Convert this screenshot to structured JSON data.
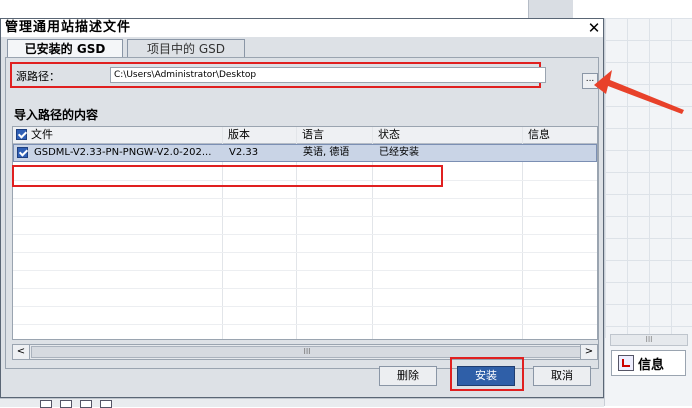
{
  "dialog": {
    "title": "管理通用站描述文件",
    "close_glyph": "✕"
  },
  "tabs": [
    {
      "label": "已安装的 GSD",
      "active": true
    },
    {
      "label": "项目中的 GSD",
      "active": false
    }
  ],
  "source": {
    "label": "源路径：",
    "path": "C:\\Users\\Administrator\\Desktop",
    "browse_label": "..."
  },
  "section_title": "导入路径的内容",
  "table": {
    "columns": [
      "文件",
      "版本",
      "语言",
      "状态",
      "信息"
    ],
    "rows": [
      {
        "checked": true,
        "file": "GSDML-V2.33-PN-PNGW-V2.0-202...",
        "version": "V2.33",
        "language": "英语, 德语",
        "status": "已经安装",
        "info": ""
      }
    ]
  },
  "scrollbar": {
    "left": "<",
    "right": ">",
    "thumb": "III"
  },
  "buttons": {
    "delete": "删除",
    "install": "安装",
    "cancel": "取消"
  },
  "background": {
    "info_tab": "信息",
    "scroll_thumb": "III"
  },
  "colors": {
    "highlight": "#e02020",
    "primary_button": "#2f5fa8",
    "selected_row": "#c9d4e6"
  }
}
